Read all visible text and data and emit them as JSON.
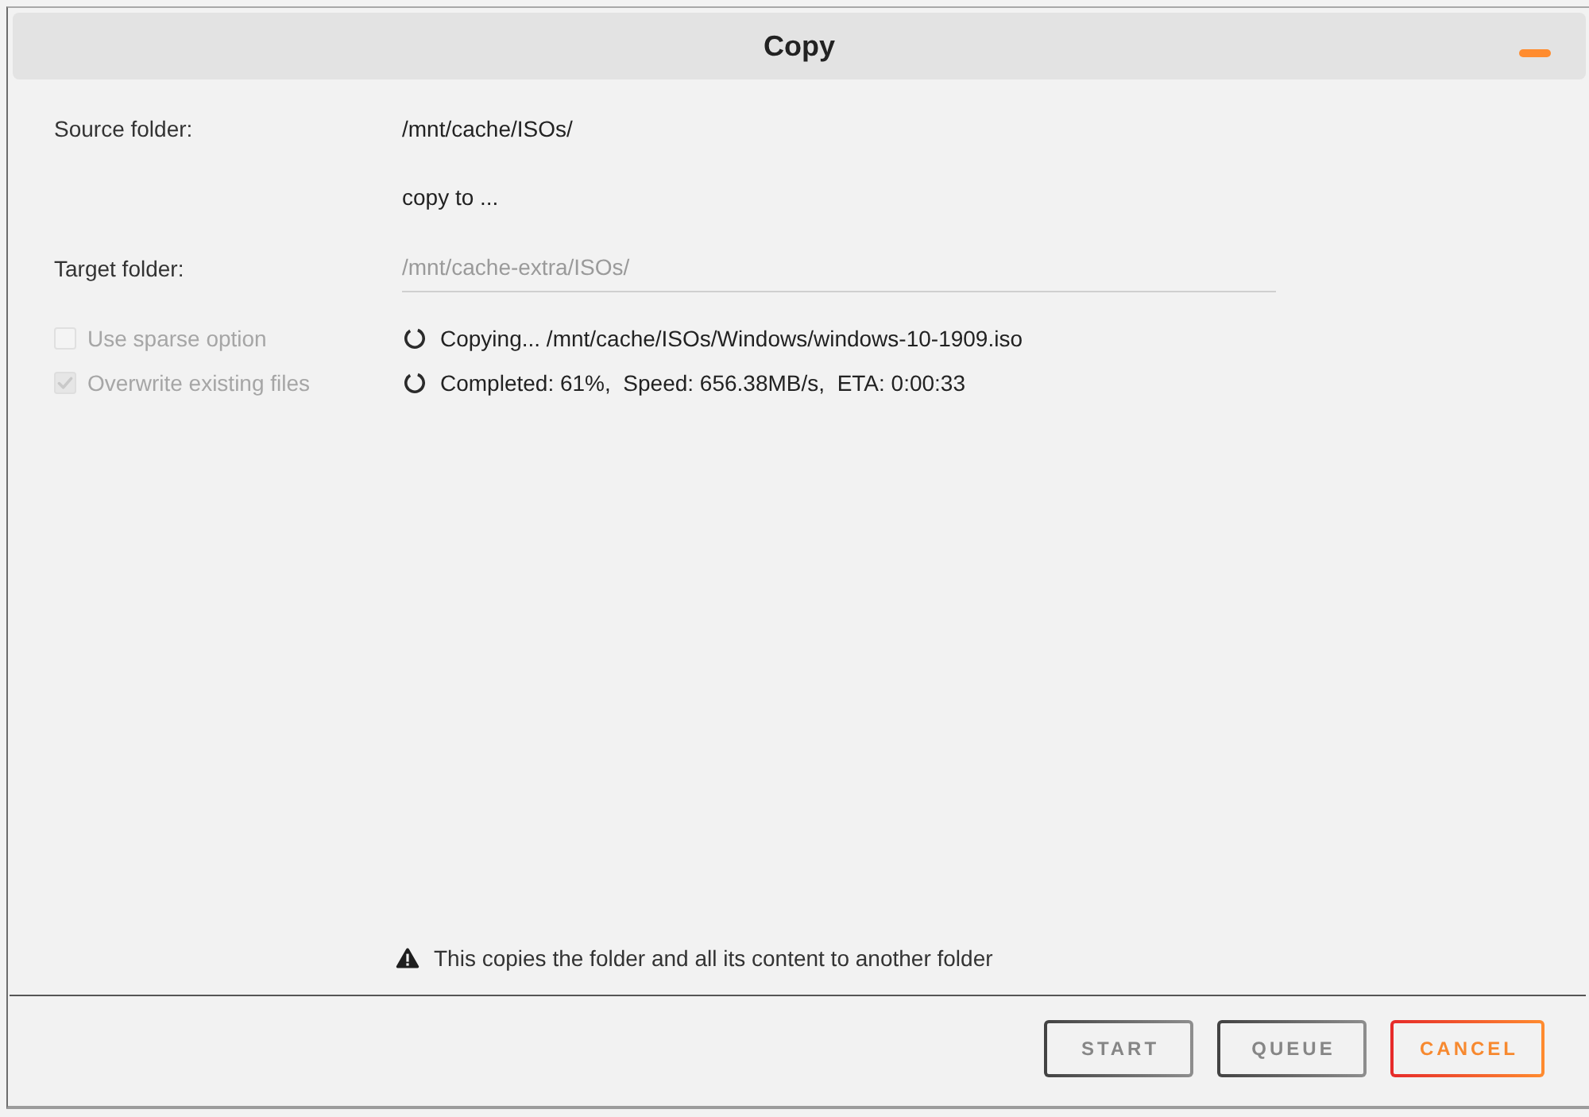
{
  "window": {
    "title": "Copy"
  },
  "source": {
    "label": "Source folder:",
    "value": "/mnt/cache/ISOs/"
  },
  "copy_to": "copy to ...",
  "target": {
    "label": "Target folder:",
    "value": "/mnt/cache-extra/ISOs/",
    "disabled": true
  },
  "options": [
    {
      "label": "Use sparse option",
      "checked": false,
      "disabled": true
    },
    {
      "label": "Overwrite existing files",
      "checked": true,
      "disabled": true
    }
  ],
  "progress": [
    "Copying... /mnt/cache/ISOs/Windows/windows-10-1909.iso",
    "Completed: 61%,  Speed: 656.38MB/s,  ETA: 0:00:33"
  ],
  "note": "This copies the folder and all its content to another folder",
  "buttons": [
    {
      "label": "START",
      "kind": "default"
    },
    {
      "label": "QUEUE",
      "kind": "default"
    },
    {
      "label": "CANCEL",
      "kind": "cancel"
    }
  ]
}
